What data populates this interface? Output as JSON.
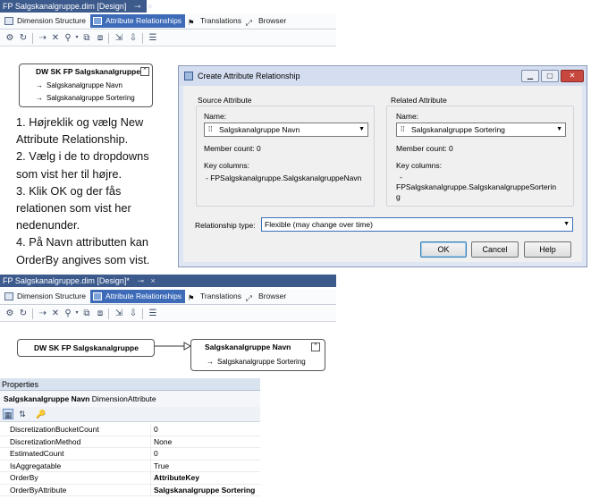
{
  "top_designer": {
    "doc_tab": "FP Salgskanalgruppe.dim [Design]",
    "tabs": [
      "Dimension Structure",
      "Attribute Relationships",
      "Translations",
      "Browser"
    ],
    "dimension_box": {
      "title": "DW SK FP Salgskanalgruppe",
      "attributes": [
        "Salgskanalgruppe Navn",
        "Salgskanalgruppe Sortering"
      ]
    }
  },
  "instructions": [
    "1. Højreklik og vælg New",
    "Attribute Relationship.",
    "2. Vælg i de to dropdowns",
    "som vist her til højre.",
    "3. Klik OK og der fås",
    "relationen som vist her",
    "nedenunder.",
    "4. På Navn attributten kan",
    "OrderBy angives som vist."
  ],
  "dialog": {
    "title": "Create Attribute Relationship",
    "source": {
      "group_label": "Source Attribute",
      "name_label": "Name:",
      "name_value": "Salgskanalgruppe Navn",
      "member_count": "Member count: 0",
      "key_columns_label": "Key columns:",
      "key_columns_value": "- FPSalgskanalgruppe.SalgskanalgruppeNavn"
    },
    "related": {
      "group_label": "Related Attribute",
      "name_label": "Name:",
      "name_value": "Salgskanalgruppe Sortering",
      "member_count": "Member count: 0",
      "key_columns_label": "Key columns:",
      "key_columns_value_1": "-",
      "key_columns_value_2": "FPSalgskanalgruppe.SalgskanalgruppeSorterin",
      "key_columns_value_3": "g"
    },
    "relationship_type_label": "Relationship type:",
    "relationship_type_value": "Flexible (may change over time)",
    "ok": "OK",
    "cancel": "Cancel",
    "help": "Help"
  },
  "bottom_designer": {
    "doc_tab": "FP Salgskanalgruppe.dim [Design]*",
    "tabs": [
      "Dimension Structure",
      "Attribute Relationships",
      "Translations",
      "Browser"
    ],
    "left_box_title": "DW SK FP Salgskanalgruppe",
    "right_box_title": "Salgskanalgruppe Navn",
    "right_box_attribute": "Salgskanalgruppe Sortering"
  },
  "properties": {
    "header": "Properties",
    "object_name": "Salgskanalgruppe Navn",
    "object_type": "DimensionAttribute",
    "rows": [
      {
        "name": "DiscretizationBucketCount",
        "value": "0"
      },
      {
        "name": "DiscretizationMethod",
        "value": "None"
      },
      {
        "name": "EstimatedCount",
        "value": "0"
      },
      {
        "name": "IsAggregatable",
        "value": "True"
      },
      {
        "name": "OrderBy",
        "value": "AttributeKey"
      },
      {
        "name": "OrderByAttribute",
        "value": "Salgskanalgruppe Sortering"
      }
    ]
  }
}
